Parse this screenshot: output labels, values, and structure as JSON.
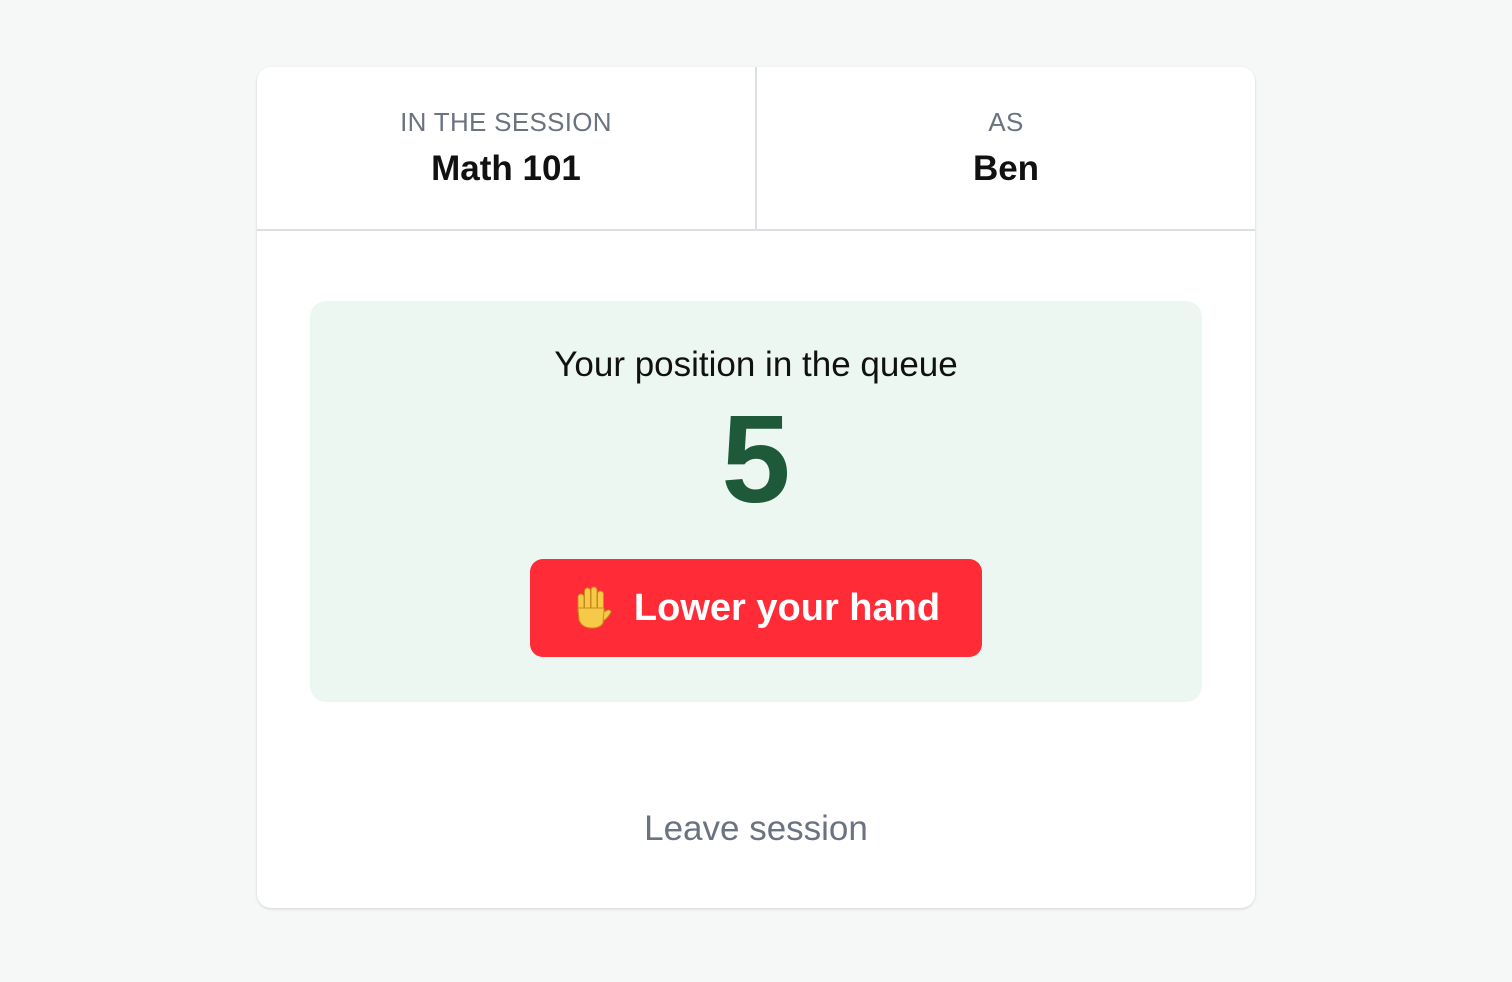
{
  "session": {
    "label": "IN THE SESSION",
    "value": "Math 101"
  },
  "user": {
    "label": "AS",
    "value": "Ben"
  },
  "queue": {
    "title": "Your position in the queue",
    "position": "5"
  },
  "actions": {
    "lower_hand_label": "Lower your hand",
    "lower_hand_icon": "raised-hand-icon",
    "leave_label": "Leave session"
  },
  "colors": {
    "background": "#f6f8f7",
    "card": "#ffffff",
    "panel": "#edf7f1",
    "position_number": "#1e5a3a",
    "lower_button": "#ff2b37",
    "muted_text": "#6b7280"
  }
}
